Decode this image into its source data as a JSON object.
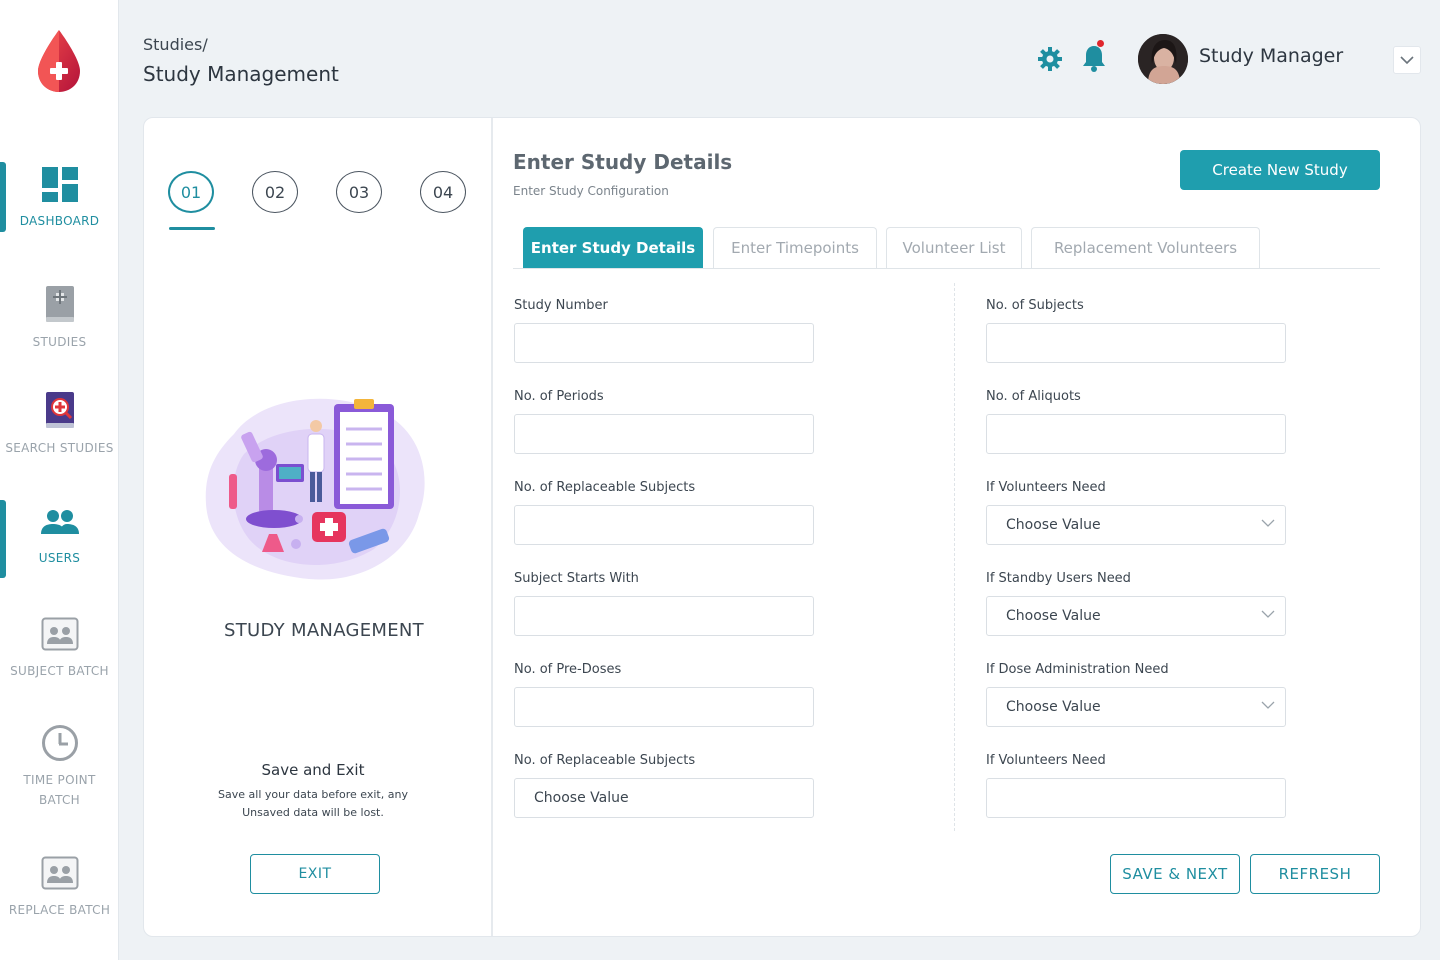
{
  "app": {
    "brand_color": "#1f8ea0",
    "accent_color": "#1f9eae",
    "logo_icon": "blood-drop-logo"
  },
  "sidebar": {
    "items": [
      {
        "label": "DASHBOARD",
        "icon": "dashboard-icon",
        "active": true
      },
      {
        "label": "STUDIES",
        "icon": "book-icon",
        "active": false
      },
      {
        "label": "SEARCH STUDIES",
        "icon": "search-book-icon",
        "active": false
      },
      {
        "label": "USERS",
        "icon": "users-icon",
        "active": true
      },
      {
        "label": "SUBJECT BATCH",
        "icon": "subject-batch-icon",
        "active": false
      },
      {
        "label": "TIME POINT BATCH",
        "icon": "clock-icon",
        "active": false
      },
      {
        "label": "REPLACE BATCH",
        "icon": "replace-batch-icon",
        "active": false
      }
    ]
  },
  "header": {
    "breadcrumb": "Studies/",
    "title": "Study Management",
    "user_name": "Study Manager",
    "has_notification": true
  },
  "steps": {
    "items": [
      "01",
      "02",
      "03",
      "04"
    ],
    "active_index": 0
  },
  "left_panel": {
    "illustration_title": "STUDY MANAGEMENT",
    "save_exit_title": "Save and Exit",
    "save_exit_desc": "Save all your data before exit, any Unsaved data will be lost.",
    "exit_label": "EXIT"
  },
  "form": {
    "title": "Enter Study Details",
    "subtitle": "Enter Study Configuration",
    "create_label": "Create New Study",
    "tabs": [
      {
        "label": "Enter Study Details",
        "active": true
      },
      {
        "label": "Enter Timepoints",
        "active": false
      },
      {
        "label": "Volunteer List",
        "active": false
      },
      {
        "label": "Replacement Volunteers",
        "active": false
      }
    ],
    "left_fields": [
      {
        "label": "Study Number",
        "type": "input",
        "value": ""
      },
      {
        "label": "No. of Periods",
        "type": "input",
        "value": ""
      },
      {
        "label": "No. of Replaceable Subjects",
        "type": "input",
        "value": ""
      },
      {
        "label": "Subject Starts With",
        "type": "input",
        "value": ""
      },
      {
        "label": "No. of Pre-Doses",
        "type": "input",
        "value": ""
      },
      {
        "label": "No. of Replaceable Subjects",
        "type": "select",
        "value": "Choose Value"
      }
    ],
    "right_fields": [
      {
        "label": "No. of Subjects",
        "type": "input",
        "value": ""
      },
      {
        "label": "No. of Aliquots",
        "type": "input",
        "value": ""
      },
      {
        "label": "If Volunteers Need",
        "type": "select",
        "value": "Choose Value"
      },
      {
        "label": "If Standby Users Need",
        "type": "select",
        "value": "Choose Value"
      },
      {
        "label": "If Dose Administration Need",
        "type": "select",
        "value": "Choose Value"
      },
      {
        "label": "If Volunteers Need",
        "type": "input",
        "value": ""
      }
    ],
    "save_label": "SAVE & NEXT",
    "refresh_label": "REFRESH"
  }
}
